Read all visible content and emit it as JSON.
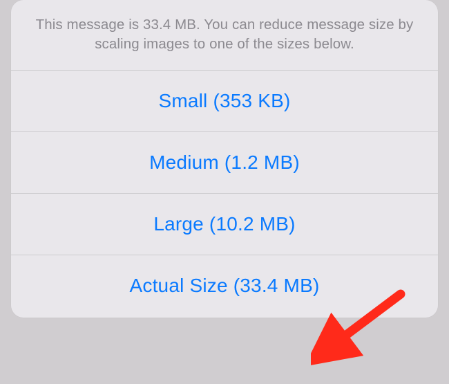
{
  "header": {
    "text": "This message is 33.4 MB. You can reduce message size by scaling images to one of the sizes below."
  },
  "options": {
    "small": "Small (353 KB)",
    "medium": "Medium (1.2 MB)",
    "large": "Large (10.2 MB)",
    "actual": "Actual Size (33.4 MB)"
  },
  "annotation": {
    "arrow_color": "#ff2a1a"
  }
}
